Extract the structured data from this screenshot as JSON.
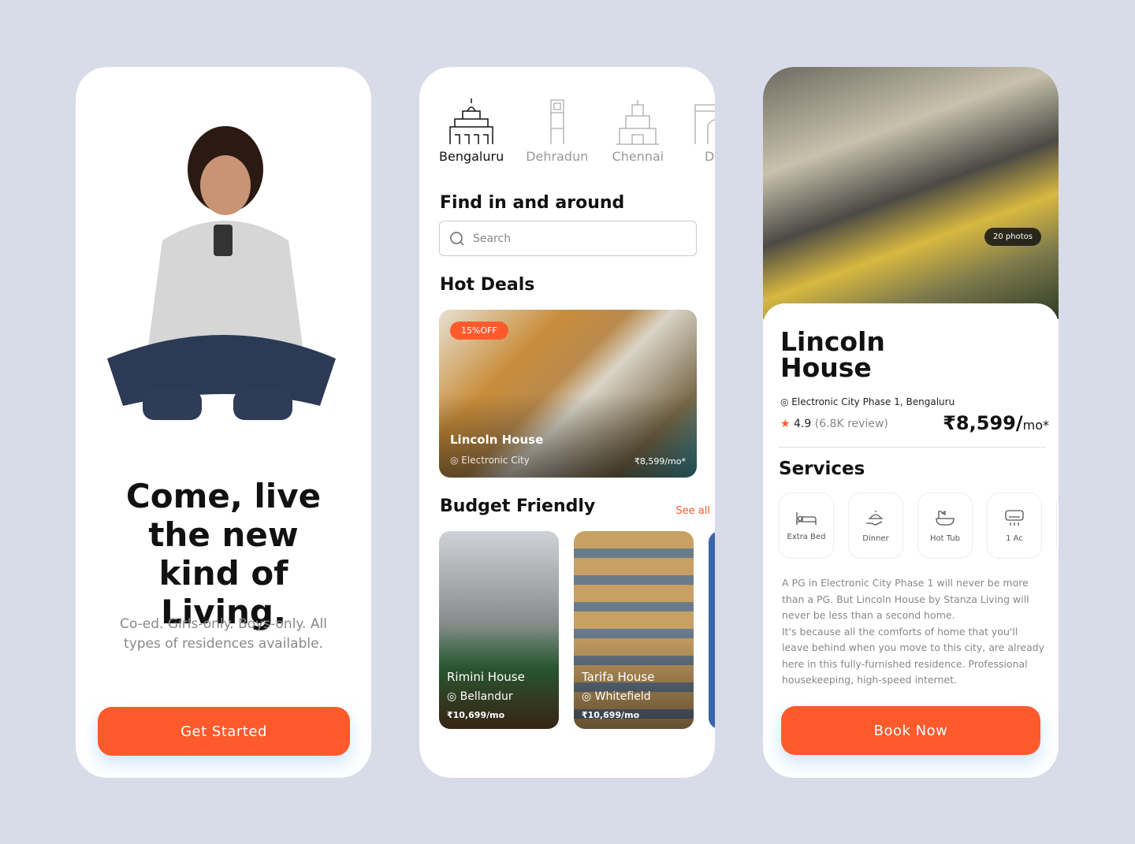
{
  "onboarding": {
    "headline": "Come, live the new kind of Living.",
    "subtitle": "Co-ed. Girls-only. Boys-only. All types of residences available.",
    "cta": "Get Started"
  },
  "home": {
    "cities": [
      {
        "name": "Bengaluru",
        "active": true
      },
      {
        "name": "Dehradun"
      },
      {
        "name": "Chennai"
      },
      {
        "name": "Del"
      }
    ],
    "find_title": "Find in and around",
    "search_placeholder": "Search",
    "hot_deals_title": "Hot Deals",
    "hot_deal": {
      "badge": "15%OFF",
      "name": "Lincoln House",
      "location": "Electronic City",
      "price": "₹8,599/mo*"
    },
    "budget_title": "Budget Friendly",
    "see_all": "See all",
    "budget": [
      {
        "name": "Rimini House",
        "location": "Bellandur",
        "price": "₹10,699/mo"
      },
      {
        "name": "Tarifa House",
        "location": "Whitefield",
        "price": "₹10,699/mo"
      }
    ]
  },
  "detail": {
    "photos": "20 photos",
    "name": "Lincoln House",
    "address": "Electronic City Phase 1, Bengaluru",
    "rating": "4.9",
    "reviews": "(6.8K review)",
    "price": "₹8,599/",
    "price_unit": "mo*",
    "services_title": "Services",
    "services": [
      {
        "label": "Extra Bed",
        "icon": "bed-icon"
      },
      {
        "label": "Dinner",
        "icon": "dinner-icon"
      },
      {
        "label": "Hot Tub",
        "icon": "bathtub-icon"
      },
      {
        "label": "1 Ac",
        "icon": "ac-icon"
      }
    ],
    "description": "A PG in Electronic City Phase 1 will never be more than a PG. But Lincoln House by Stanza Living will never be less than a second home.\nIt's because all the comforts of home that you'll leave behind when you move to this city, are already here in this fully-furnished residence. Professional housekeeping, high-speed internet.",
    "cta": "Book Now"
  },
  "colors": {
    "accent": "#ff5a2c",
    "background": "#d8dbe8"
  }
}
